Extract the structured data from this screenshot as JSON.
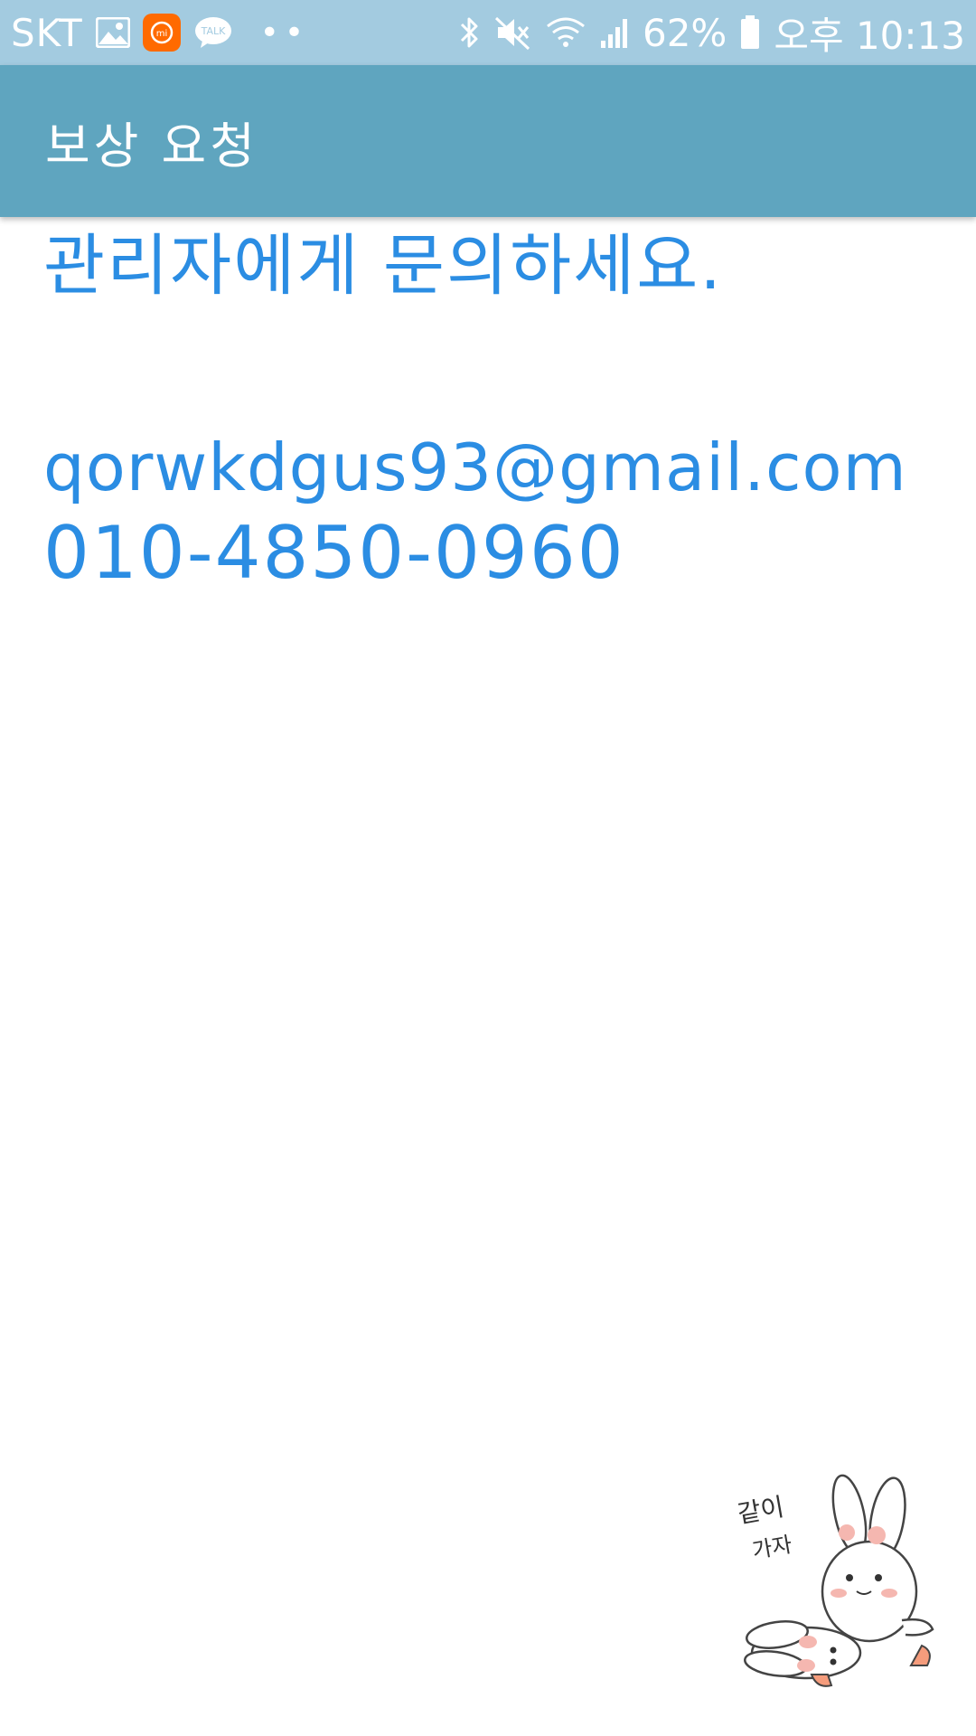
{
  "status_bar": {
    "carrier": "SKT",
    "app_mi_label": "mi",
    "talk_label": "TALK",
    "dots": "••",
    "battery_percent": "62%",
    "time": "오후 10:13",
    "icons": [
      "gallery-icon",
      "mi-app-icon",
      "kakaotalk-icon",
      "bluetooth-icon",
      "mute-icon",
      "wifi-icon",
      "signal-icon",
      "battery-icon"
    ]
  },
  "app_bar": {
    "title": "보상 요청"
  },
  "main": {
    "heading": "관리자에게 문의하세요.",
    "email": "qorwkdgus93@gmail.com",
    "phone": "010-4850-0960"
  },
  "sticker": {
    "text_line1": "같이",
    "text_line2": "가자"
  },
  "colors": {
    "status_bar_bg": "#a3cbe0",
    "app_bar_bg": "#5fa5bf",
    "accent_text": "#2b8de3"
  }
}
